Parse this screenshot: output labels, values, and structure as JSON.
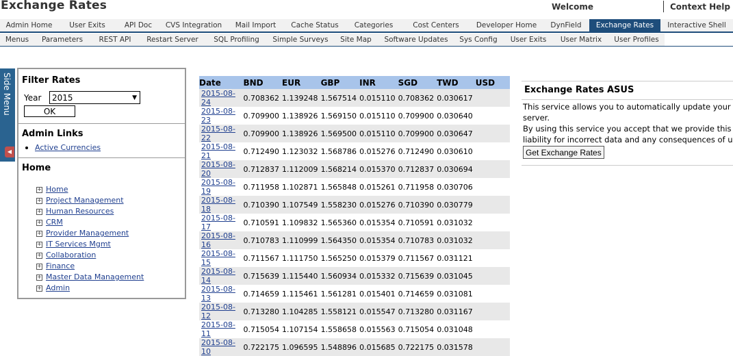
{
  "header": {
    "title": "Exchange Rates",
    "welcome": "Welcome",
    "context_help": "Context Help"
  },
  "tabs_row1": [
    {
      "label": "Admin Home"
    },
    {
      "label": "User Exits"
    },
    {
      "label": "API Doc"
    },
    {
      "label": "CVS Integration"
    },
    {
      "label": "Mail Import"
    },
    {
      "label": "Cache Status"
    },
    {
      "label": "Categories"
    },
    {
      "label": "Cost Centers"
    },
    {
      "label": "Developer Home"
    },
    {
      "label": "DynField"
    },
    {
      "label": "Exchange Rates",
      "active": true
    },
    {
      "label": "Interactive Shell"
    }
  ],
  "tabs_row2": [
    {
      "label": "Menus"
    },
    {
      "label": "Parameters"
    },
    {
      "label": "REST API"
    },
    {
      "label": "Restart Server"
    },
    {
      "label": "SQL Profiling"
    },
    {
      "label": "Simple Surveys"
    },
    {
      "label": "Site Map"
    },
    {
      "label": "Software Updates"
    },
    {
      "label": "Sys Config"
    },
    {
      "label": "User Exits"
    },
    {
      "label": "User Matrix"
    },
    {
      "label": "User Profiles"
    }
  ],
  "side_menu": {
    "label": "Side Menu"
  },
  "filter": {
    "title": "Filter Rates",
    "year_label": "Year",
    "year_value": "2015",
    "ok_label": "OK"
  },
  "admin_links": {
    "title": "Admin Links",
    "items": [
      {
        "label": "Active Currencies"
      }
    ]
  },
  "home": {
    "title": "Home",
    "items": [
      {
        "label": "Home"
      },
      {
        "label": "Project Management"
      },
      {
        "label": "Human Resources"
      },
      {
        "label": "CRM"
      },
      {
        "label": "Provider Management"
      },
      {
        "label": "IT Services Mgmt"
      },
      {
        "label": "Collaboration"
      },
      {
        "label": "Finance"
      },
      {
        "label": "Master Data Management"
      },
      {
        "label": "Admin"
      }
    ]
  },
  "rates_table": {
    "columns": [
      "Date",
      "BND",
      "EUR",
      "GBP",
      "INR",
      "SGD",
      "TWD",
      "USD"
    ],
    "rows": [
      [
        "2015-08-24",
        "0.708362",
        "1.139248",
        "1.567514",
        "0.015110",
        "0.708362",
        "0.030617",
        ""
      ],
      [
        "2015-08-23",
        "0.709900",
        "1.138926",
        "1.569150",
        "0.015110",
        "0.709900",
        "0.030640",
        ""
      ],
      [
        "2015-08-22",
        "0.709900",
        "1.138926",
        "1.569500",
        "0.015110",
        "0.709900",
        "0.030647",
        ""
      ],
      [
        "2015-08-21",
        "0.712490",
        "1.123032",
        "1.568786",
        "0.015276",
        "0.712490",
        "0.030610",
        ""
      ],
      [
        "2015-08-20",
        "0.712837",
        "1.112009",
        "1.568214",
        "0.015370",
        "0.712837",
        "0.030694",
        ""
      ],
      [
        "2015-08-19",
        "0.711958",
        "1.102871",
        "1.565848",
        "0.015261",
        "0.711958",
        "0.030706",
        ""
      ],
      [
        "2015-08-18",
        "0.710390",
        "1.107549",
        "1.558230",
        "0.015276",
        "0.710390",
        "0.030779",
        ""
      ],
      [
        "2015-08-17",
        "0.710591",
        "1.109832",
        "1.565360",
        "0.015354",
        "0.710591",
        "0.031032",
        ""
      ],
      [
        "2015-08-16",
        "0.710783",
        "1.110999",
        "1.564350",
        "0.015354",
        "0.710783",
        "0.031032",
        ""
      ],
      [
        "2015-08-15",
        "0.711567",
        "1.111750",
        "1.565250",
        "0.015379",
        "0.711567",
        "0.031121",
        ""
      ],
      [
        "2015-08-14",
        "0.715639",
        "1.115440",
        "1.560934",
        "0.015332",
        "0.715639",
        "0.031045",
        ""
      ],
      [
        "2015-08-13",
        "0.714659",
        "1.115461",
        "1.561281",
        "0.015401",
        "0.714659",
        "0.031081",
        ""
      ],
      [
        "2015-08-12",
        "0.713280",
        "1.104285",
        "1.558121",
        "0.015547",
        "0.713280",
        "0.031167",
        ""
      ],
      [
        "2015-08-11",
        "0.715054",
        "1.107154",
        "1.558658",
        "0.015563",
        "0.715054",
        "0.031048",
        ""
      ],
      [
        "2015-08-10",
        "0.722175",
        "1.096595",
        "1.548896",
        "0.015685",
        "0.722175",
        "0.031578",
        ""
      ]
    ]
  },
  "service": {
    "title": "Exchange Rates ASUS",
    "lines": [
      "This service allows you to automatically update your e",
      "server.",
      "By using this service you accept that we provide this s",
      "liability for incorrect data and any consequences of us"
    ],
    "button_label": "Get Exchange Rates"
  },
  "colors": {
    "brand_blue": "#1e4d7b",
    "table_header": "#a8c4ea",
    "link": "#1f3f8f"
  }
}
